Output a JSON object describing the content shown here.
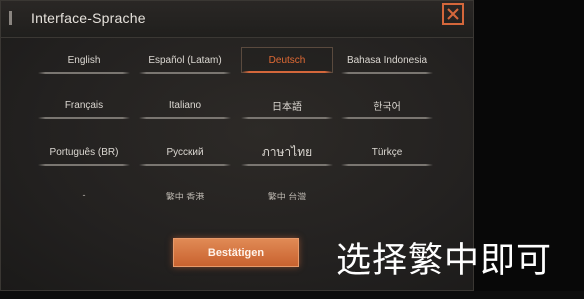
{
  "dialog": {
    "title": "Interface-Sprache",
    "confirm_label": "Bestätigen"
  },
  "languages": [
    {
      "label": "English",
      "selected": false
    },
    {
      "label": "Español (Latam)",
      "selected": false
    },
    {
      "label": "Deutsch",
      "selected": true
    },
    {
      "label": "Bahasa Indonesia",
      "selected": false
    },
    {
      "label": "Français",
      "selected": false
    },
    {
      "label": "Italiano",
      "selected": false
    },
    {
      "label": "日本語",
      "selected": false
    },
    {
      "label": "한국어",
      "selected": false
    },
    {
      "label": "Português (BR)",
      "selected": false
    },
    {
      "label": "Русский",
      "selected": false
    },
    {
      "label": "ภาษาไทย",
      "selected": false
    },
    {
      "label": "Türkçe",
      "selected": false
    },
    {
      "label": "-",
      "selected": false
    },
    {
      "label": "繁中 香港",
      "selected": false
    },
    {
      "label": "繁中 台灣",
      "selected": false
    }
  ],
  "overlay_caption": "选择繁中即可",
  "colors": {
    "accent": "#d4673b",
    "background": "#232120",
    "text": "#dcd8d2"
  },
  "icons": {
    "close": "close-icon"
  }
}
